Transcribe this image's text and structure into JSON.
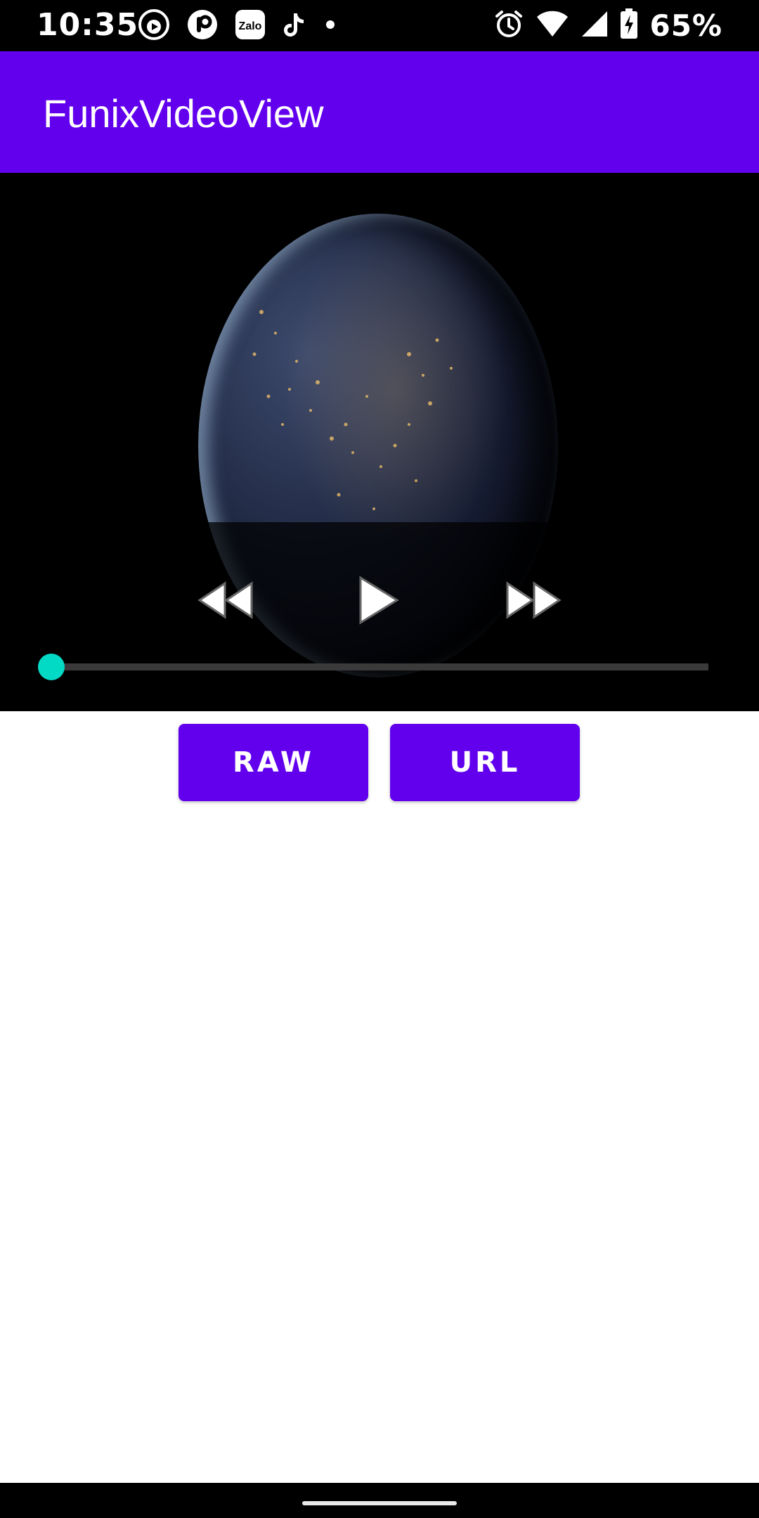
{
  "status_bar": {
    "time": "10:35",
    "battery": "65%",
    "left_icons": [
      "podcast-icon",
      "pixel-app-icon",
      "zalo-icon",
      "tiktok-icon",
      "dot-icon"
    ],
    "zalo_label": "Zalo",
    "right_icons": [
      "alarm-icon",
      "wifi-icon",
      "signal-icon",
      "battery-charging-icon"
    ]
  },
  "app_bar": {
    "title": "FunixVideoView",
    "color": "#6200ee"
  },
  "video": {
    "controls": [
      "rewind-icon",
      "play-icon",
      "fast-forward-icon"
    ],
    "progress": 0.0,
    "accent_color": "#03dac5"
  },
  "buttons": {
    "raw_label": "RAW",
    "url_label": "URL"
  }
}
